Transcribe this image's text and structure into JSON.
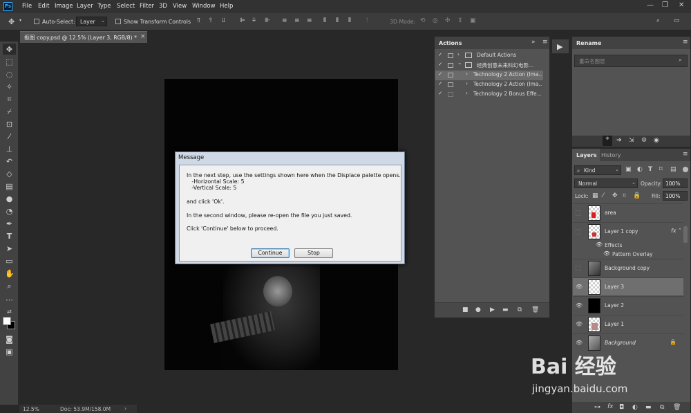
{
  "app": {
    "logo": "Ps"
  },
  "menu": [
    "File",
    "Edit",
    "Image",
    "Layer",
    "Type",
    "Select",
    "Filter",
    "3D",
    "View",
    "Window",
    "Help"
  ],
  "window_controls": {
    "minimize": "—",
    "restore": "❐",
    "close": "✕"
  },
  "options": {
    "auto_select_label": "Auto-Select:",
    "auto_select_value": "Layer",
    "show_transform_label": "Show Transform Controls",
    "mode_3d_label": "3D Mode:"
  },
  "document": {
    "tab_title": "抠图 copy.psd @ 12.5% (Layer 3, RGB/8) *",
    "tab_close": "×"
  },
  "status": {
    "zoom": "12.5%",
    "doc": "Doc: 53.9M/158.0M",
    "arrow": "›"
  },
  "actions_panel": {
    "title": "Actions",
    "rows": [
      {
        "label": "Default Actions",
        "checked": "✓",
        "arrow": "›"
      },
      {
        "label": "经典创意未来科幻电影...",
        "checked": "✓",
        "arrow": "⌄"
      },
      {
        "label": "Technology 2 Action (Ima...",
        "checked": "✓",
        "arrow": "›"
      },
      {
        "label": "Technology 2 Action (Ima...",
        "checked": "✓",
        "arrow": "›"
      },
      {
        "label": "Technology 2 Bonus Effe...",
        "checked": "✓",
        "arrow": "›"
      }
    ]
  },
  "rename_panel": {
    "title": "Rename",
    "placeholder": "重命名图层"
  },
  "dialog": {
    "title": "Message",
    "lines": [
      "In the next step, use the settings shown here when the Displace palette opens.",
      "   -Horizontal Scale: 5",
      "   -Vertical Scale: 5",
      "and click 'Ok'.",
      "In the second window, please re-open the file you just saved.",
      "Click 'Continue' below to proceed."
    ],
    "continue_label": "Continue",
    "stop_label": "Stop"
  },
  "layers_panel": {
    "tabs": [
      "Layers",
      "History"
    ],
    "kind_label": "Kind",
    "blend_mode": "Normal",
    "opacity_label": "Opacity:",
    "opacity_value": "100%",
    "lock_label": "Lock:",
    "fill_label": "Fill:",
    "fill_value": "100%",
    "fx_label": "fx",
    "effects_label": "Effects",
    "pattern_overlay_label": "Pattern Overlay",
    "layers": [
      {
        "name": "area",
        "visible": false
      },
      {
        "name": "Layer 1 copy",
        "visible": false
      },
      {
        "name": "Background copy",
        "visible": false
      },
      {
        "name": "Layer 3",
        "visible": true,
        "selected": true
      },
      {
        "name": "Layer 2",
        "visible": true
      },
      {
        "name": "Layer 1",
        "visible": true
      },
      {
        "name": "Background",
        "visible": true,
        "locked": true
      }
    ]
  },
  "watermark": {
    "brand": "Bai 经验",
    "url": "jingyan.baidu.com"
  },
  "colors": {
    "accent": "#31a8ff",
    "panel": "#535353",
    "bg": "#282828",
    "dialog": "#cfd9e5"
  }
}
